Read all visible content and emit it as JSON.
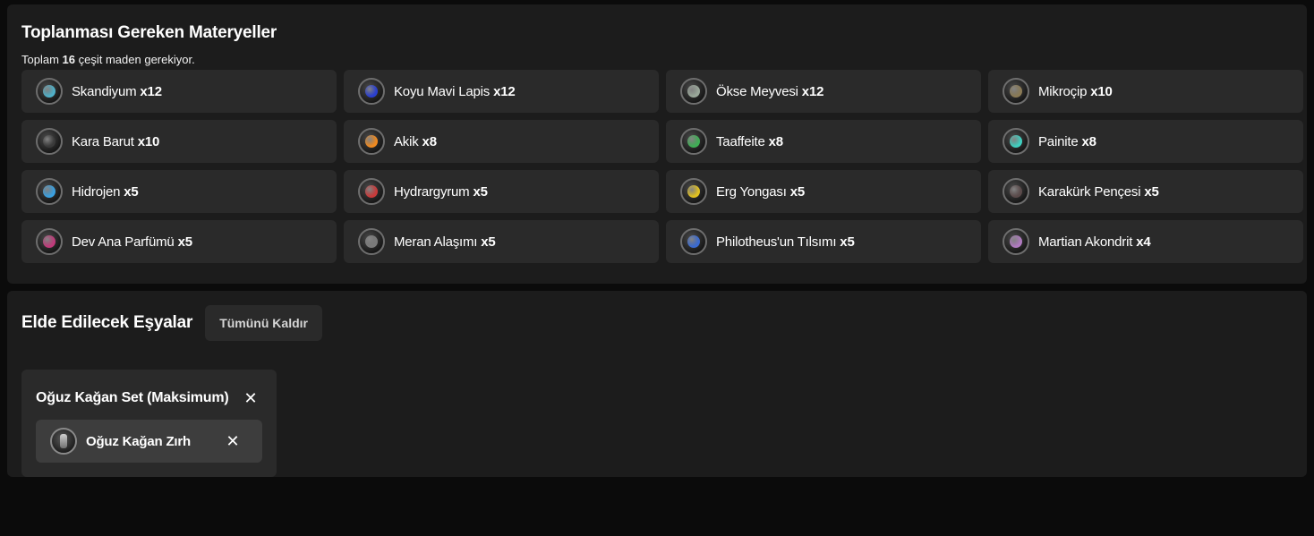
{
  "materials": {
    "title": "Toplanması Gereken Materyeller",
    "summary_prefix": "Toplam",
    "summary_count": "16",
    "summary_suffix": "çeşit maden gerekiyor.",
    "items": [
      {
        "name": "Skandiyum",
        "qty": "x12",
        "icon": "skandiyum-icon",
        "color": "#4fb0c8"
      },
      {
        "name": "Koyu Mavi Lapis",
        "qty": "x12",
        "icon": "lapis-icon",
        "color": "#2a3fd0"
      },
      {
        "name": "Ökse Meyvesi",
        "qty": "x12",
        "icon": "okse-meyvesi-icon",
        "color": "#9aa89a"
      },
      {
        "name": "Mikroçip",
        "qty": "x10",
        "icon": "microchip-icon",
        "color": "#8a7a55"
      },
      {
        "name": "Kara Barut",
        "qty": "x10",
        "icon": "kara-barut-icon",
        "color": "#3a3a3a"
      },
      {
        "name": "Akik",
        "qty": "x8",
        "icon": "akik-icon",
        "color": "#f08a20"
      },
      {
        "name": "Taaffeite",
        "qty": "x8",
        "icon": "taaffeite-icon",
        "color": "#3fae55"
      },
      {
        "name": "Painite",
        "qty": "x8",
        "icon": "painite-icon",
        "color": "#3fd0c0"
      },
      {
        "name": "Hidrojen",
        "qty": "x5",
        "icon": "hidrojen-icon",
        "color": "#3aa0e0"
      },
      {
        "name": "Hydrargyrum",
        "qty": "x5",
        "icon": "hydrargyrum-icon",
        "color": "#c83a3a"
      },
      {
        "name": "Erg Yongası",
        "qty": "x5",
        "icon": "erg-yongasi-icon",
        "color": "#e0c020"
      },
      {
        "name": "Karakürk Pençesi",
        "qty": "x5",
        "icon": "karakurk-pencesi-icon",
        "color": "#5a4a4a"
      },
      {
        "name": "Dev Ana Parfümü",
        "qty": "x5",
        "icon": "dev-ana-parfumu-icon",
        "color": "#c03a7a"
      },
      {
        "name": "Meran Alaşımı",
        "qty": "x5",
        "icon": "meran-alasimi-icon",
        "color": "#7a7a7a"
      },
      {
        "name": "Philotheus'un Tılsımı",
        "qty": "x5",
        "icon": "philotheus-tilsimi-icon",
        "color": "#3a6ad0"
      },
      {
        "name": "Martian Akondrit",
        "qty": "x4",
        "icon": "martian-akondrit-icon",
        "color": "#b07ac0"
      }
    ]
  },
  "items_section": {
    "title": "Elde Edilecek Eşyalar",
    "remove_all_label": "Tümünü Kaldır",
    "sets": [
      {
        "title": "Oğuz Kağan Set (Maksimum)",
        "close_icon": "close-icon",
        "items": [
          {
            "label": "Oğuz Kağan Zırh",
            "icon": "armor-icon",
            "close_icon": "close-icon"
          }
        ]
      }
    ]
  }
}
